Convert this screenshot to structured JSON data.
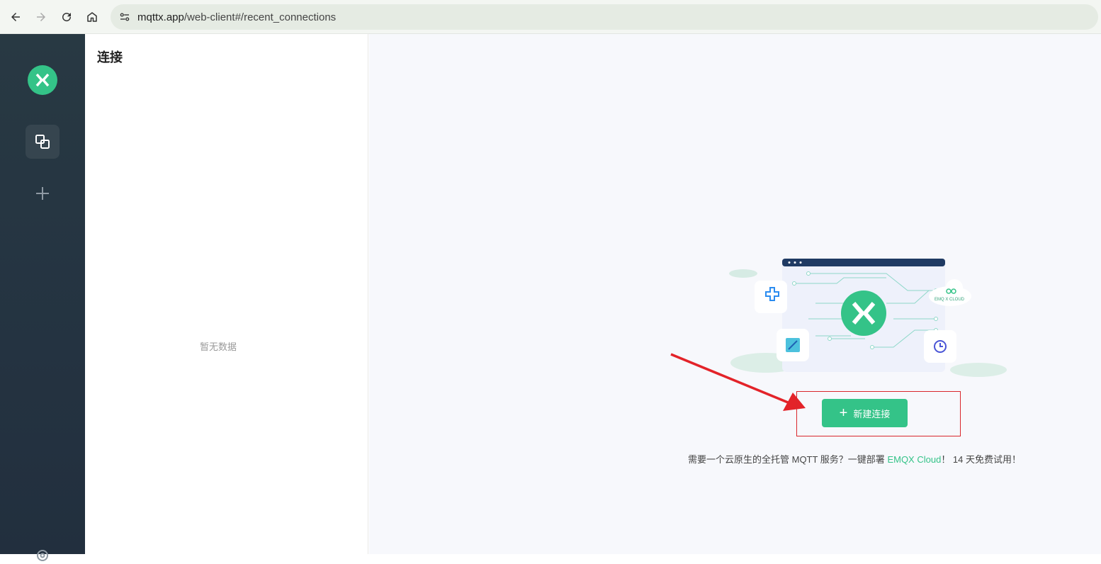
{
  "browser": {
    "url_host": "mqttx.app",
    "url_path": "/web-client#/recent_connections"
  },
  "sidebar": {
    "items": [
      {
        "name": "connections",
        "icon": "connections-icon",
        "active": true
      },
      {
        "name": "new",
        "icon": "plus-icon",
        "active": false
      }
    ]
  },
  "list_panel": {
    "title": "连接",
    "empty_text": "暂无数据"
  },
  "main": {
    "new_button_label": "新建连接",
    "promo_prefix": "需要一个云原生的全托管 MQTT 服务？一键部署 ",
    "promo_link": "EMQX Cloud",
    "promo_suffix": "！ 14 天免费试用！",
    "illustration_badge": "EMQ X CLOUD"
  },
  "colors": {
    "accent": "#34c388",
    "sidebar_bg": "#283943",
    "highlight": "#d9262c"
  }
}
